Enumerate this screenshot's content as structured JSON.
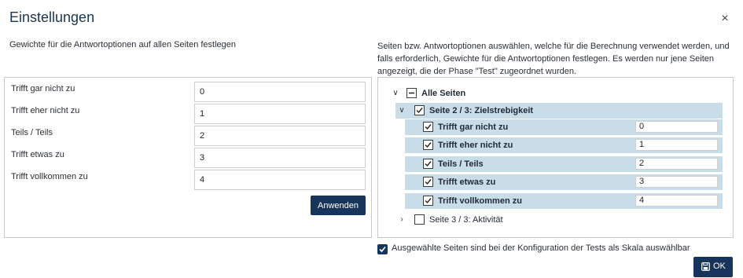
{
  "dialog": {
    "title": "Einstellungen",
    "close_icon": "×"
  },
  "left": {
    "heading": "Gewichte für die Antwortoptionen auf allen Seiten festlegen",
    "rows": [
      {
        "label": "Trifft gar nicht zu",
        "value": "0"
      },
      {
        "label": "Trifft eher nicht zu",
        "value": "1"
      },
      {
        "label": "Teils / Teils",
        "value": "2"
      },
      {
        "label": "Trifft etwas zu",
        "value": "3"
      },
      {
        "label": "Trifft vollkommen zu",
        "value": "4"
      }
    ],
    "apply_label": "Anwenden"
  },
  "right": {
    "heading": "Seiten bzw. Antwortoptionen auswählen, welche für die Berechnung verwendet werden, und falls erforderlich, Gewichte für die Antwortoptionen festlegen. Es werden nur jene Seiten angezeigt, die der Phase \"Test\" zugeordnet wurden.",
    "tree": {
      "root": {
        "label": "Alle Seiten",
        "state": "indeterminate",
        "expanded": true
      },
      "page2": {
        "label": "Seite 2 / 3: Zielstrebigkeit",
        "checked": true,
        "expanded": true
      },
      "options": [
        {
          "label": "Trifft gar nicht zu",
          "value": "0",
          "checked": true
        },
        {
          "label": "Trifft eher nicht zu",
          "value": "1",
          "checked": true
        },
        {
          "label": "Teils / Teils",
          "value": "2",
          "checked": true
        },
        {
          "label": "Trifft etwas zu",
          "value": "3",
          "checked": true
        },
        {
          "label": "Trifft vollkommen zu",
          "value": "4",
          "checked": true
        }
      ],
      "page3": {
        "label": "Seite 3 / 3: Aktivität",
        "checked": false,
        "expanded": false
      }
    }
  },
  "footer": {
    "scale_checkbox_checked": true,
    "scale_checkbox_label": "Ausgewählte Seiten sind bei der Konfiguration der Tests als Skala auswählbar",
    "ok_label": "OK"
  },
  "colors": {
    "primary": "#17345a",
    "highlight": "#c9dde8",
    "border": "#c9c9c9"
  }
}
